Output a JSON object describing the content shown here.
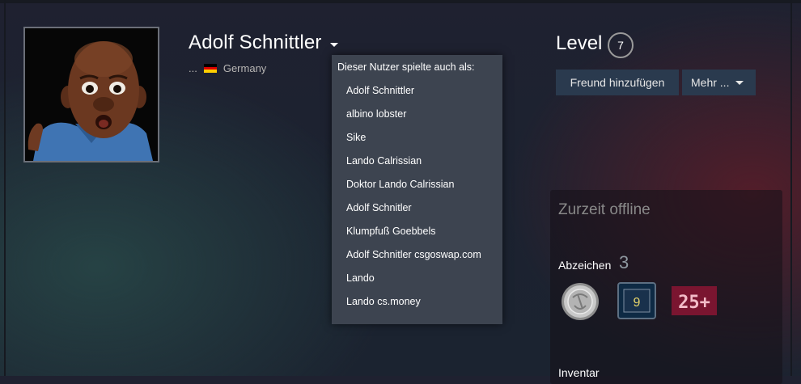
{
  "profile": {
    "name": "Adolf Schnittler",
    "summary": "...",
    "country": "Germany",
    "country_flag_colors": [
      "#000000",
      "#dd0000",
      "#ffce00"
    ]
  },
  "aliases_dropdown": {
    "title": "Dieser Nutzer spielte auch als:",
    "items": [
      {
        "label": "Adolf Schnittler"
      },
      {
        "label": "albino lobster"
      },
      {
        "label": "Sike"
      },
      {
        "label": "Lando Calrissian"
      },
      {
        "label": "Doktor Lando Calrissian"
      },
      {
        "label": "Adolf Schnitler"
      },
      {
        "label": "Klumpfuß Goebbels"
      },
      {
        "label": "Adolf Schnitler csgoswap.com"
      },
      {
        "label": "Lando"
      },
      {
        "label": "Lando cs.money"
      }
    ]
  },
  "level": {
    "label": "Level",
    "value": "7"
  },
  "actions": {
    "add_friend": "Freund hinzufügen",
    "more": "Mehr ..."
  },
  "sidebar": {
    "status": "Zurzeit offline",
    "badges": {
      "label": "Abzeichen",
      "count": "3",
      "items": [
        {
          "icon": "silver-coin-badge-icon"
        },
        {
          "icon": "years-of-service-9-badge-icon",
          "text": "9"
        },
        {
          "icon": "level-25-badge-icon",
          "text": "25+"
        }
      ]
    },
    "inventory_label": "Inventar"
  },
  "colors": {
    "dropdown_bg": "#3d4450",
    "button_bg": "#2a3a4e",
    "status_offline": "#898989"
  }
}
